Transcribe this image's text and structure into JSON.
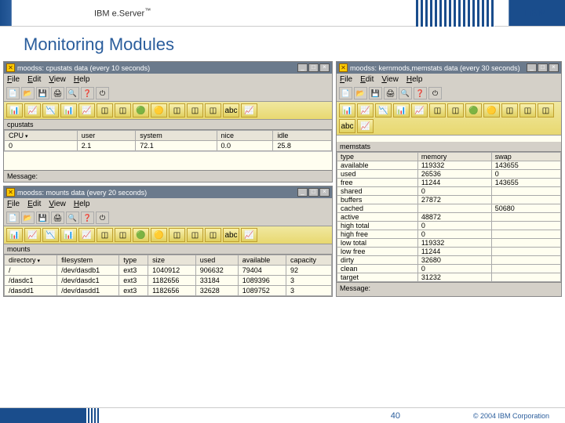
{
  "header": {
    "brand": "IBM e.Server",
    "tm": "™",
    "logo": "IBM"
  },
  "slide_title": "Monitoring Modules",
  "menus": {
    "file": "File",
    "edit": "Edit",
    "view": "View",
    "help": "Help"
  },
  "toolbar_icons": [
    "📄",
    "📂",
    "💾",
    "🖨",
    "🔍",
    "❓",
    "⏻"
  ],
  "chart_icons": [
    "📊",
    "📈",
    "📉",
    "📊",
    "📈",
    "◫",
    "◫",
    "🟢",
    "🟡",
    "◫",
    "◫",
    "◫",
    "abc",
    "📈"
  ],
  "message_label": "Message:",
  "win_cpu": {
    "title": "moodss: cpustats data (every 10 seconds)",
    "label": "cpustats",
    "headers": [
      "CPU",
      "user",
      "system",
      "nice",
      "idle"
    ],
    "sorted_col": 0,
    "rows": [
      [
        "0",
        "2.1",
        "72.1",
        "0.0",
        "25.8"
      ]
    ]
  },
  "win_mounts": {
    "title": "moodss: mounts data (every 20 seconds)",
    "label": "mounts",
    "headers": [
      "directory",
      "filesystem",
      "type",
      "size",
      "used",
      "available",
      "capacity"
    ],
    "sorted_col": 0,
    "rows": [
      [
        "/",
        "/dev/dasdb1",
        "ext3",
        "1040912",
        "906632",
        "79404",
        "92"
      ],
      [
        "/dasdc1",
        "/dev/dasdc1",
        "ext3",
        "1182656",
        "33184",
        "1089396",
        "3"
      ],
      [
        "/dasdd1",
        "/dev/dasdd1",
        "ext3",
        "1182656",
        "32628",
        "1089752",
        "3"
      ]
    ]
  },
  "win_mem": {
    "title": "moodss: kernmods,memstats data (every 30 seconds)",
    "label": "memstats",
    "mem_headers": [
      "type",
      "memory",
      "swap"
    ],
    "mem_rows": [
      [
        "available",
        "119332",
        "143655"
      ],
      [
        "used",
        "26536",
        "0"
      ],
      [
        "free",
        "11244",
        "143655"
      ],
      [
        "shared",
        "0",
        ""
      ],
      [
        "buffers",
        "27872",
        ""
      ],
      [
        "cached",
        "",
        "50680"
      ],
      [
        "active",
        "48872",
        ""
      ],
      [
        "high total",
        "0",
        ""
      ],
      [
        "high free",
        "0",
        ""
      ],
      [
        "low total",
        "119332",
        ""
      ],
      [
        "low free",
        "11244",
        ""
      ],
      [
        "dirty",
        "32680",
        ""
      ],
      [
        "clean",
        "0",
        ""
      ],
      [
        "target",
        "31232",
        ""
      ]
    ]
  },
  "footer": {
    "page": "40",
    "copyright": "© 2004 IBM Corporation"
  }
}
